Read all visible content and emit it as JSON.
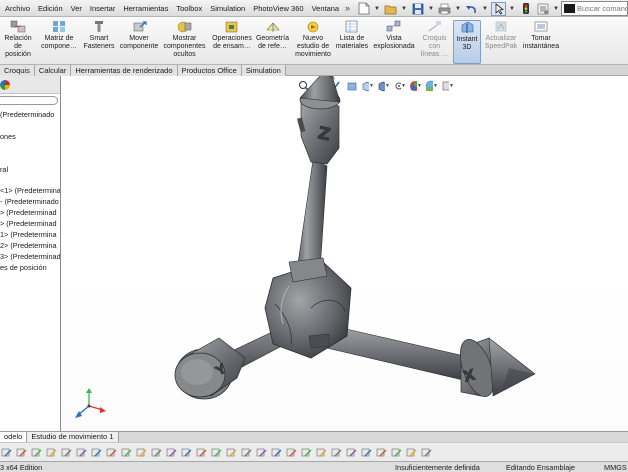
{
  "menubar": {
    "items": [
      "Archivo",
      "Edición",
      "Ver",
      "Insertar",
      "Herramientas",
      "Toolbox",
      "Simulation",
      "PhotoView 360",
      "Ventana"
    ],
    "more_arrow": "»",
    "quick_tools": [
      "new-document-icon",
      "open-folder-icon",
      "save-icon",
      "print-icon",
      "undo-icon",
      "select-pointer-icon",
      "rebuild-icon",
      "options-icon"
    ],
    "search_placeholder": "Buscar comandos"
  },
  "ribbon": {
    "buttons": [
      {
        "label": "Relación\nde\nposición",
        "icon": "mate-icon"
      },
      {
        "label": "Matriz de\ncompone…",
        "icon": "pattern-icon"
      },
      {
        "label": "Smart\nFasteners",
        "icon": "fastener-icon"
      },
      {
        "label": "Mover\ncomponente",
        "icon": "move-component-icon"
      },
      {
        "label": "Mostrar\ncomponentes\nocultos",
        "icon": "show-hidden-icon"
      },
      {
        "label": "Operaciones\nde ensam…",
        "icon": "assembly-features-icon"
      },
      {
        "label": "Geometría\nde refe…",
        "icon": "reference-geometry-icon"
      },
      {
        "label": "Nuevo\nestudio de\nmovimiento",
        "icon": "motion-study-icon"
      },
      {
        "label": "Lista de\nmateriales",
        "icon": "bom-icon"
      },
      {
        "label": "Vista\nexplosionada",
        "icon": "exploded-view-icon"
      },
      {
        "label": "Croquis\ncon\nlíneas …",
        "icon": "explode-line-icon"
      },
      {
        "label": "Instant\n3D",
        "icon": "instant3d-icon"
      },
      {
        "label": "Actualizar\nSpeedPak",
        "icon": "speedpak-icon"
      },
      {
        "label": "Tomar\ninstantánea",
        "icon": "snapshot-icon"
      }
    ]
  },
  "command_tabs": [
    "Croquis",
    "Calcular",
    "Herramientas de renderizado",
    "Productos Office",
    "Simulation"
  ],
  "feature_tree": {
    "rows": [
      "(Predeterminado",
      "",
      "ones",
      "",
      "",
      "ral",
      "",
      "<1> (Predetermina",
      "- (Predeterminado",
      "> (Predeterminad",
      "> (Predeterminad",
      "1> (Predetermina",
      "2> (Predetermina",
      "3> (Predeterminad",
      "es de posición"
    ]
  },
  "heads_up": [
    "zoom-to-fit-icon",
    "zoom-area-icon",
    "previous-view-icon",
    "section-view-icon",
    "view-orientation-icon",
    "display-style-icon",
    "hide-show-icon",
    "edit-appearance-icon",
    "apply-scene-icon",
    "view-settings-icon"
  ],
  "model": {
    "letter_marks": [
      "Z",
      "Y",
      "X"
    ],
    "colors": {
      "body": "#6d6f73",
      "light": "#9a9ca0",
      "dark": "#2e2f33",
      "mid": "#50525a"
    }
  },
  "bottom_tabs": {
    "items": [
      "odelo",
      "Estudio de movimiento 1"
    ],
    "active": 0
  },
  "motion_toolbar": [
    "rotate-icon",
    "zoom-icon",
    "pan-icon",
    "rotate-view-icon",
    "motion-icon",
    "gravity-icon",
    "contact-icon",
    "motor-icon",
    "spring-icon",
    "damper-icon",
    "force-icon",
    "calculate-icon",
    "results-icon",
    "play-icon",
    "stop-icon",
    "settings-icon",
    "camera-icon",
    "export-icon",
    "key-icon",
    "timeline-icon",
    "animation-icon",
    "wizard-icon",
    "playback-icon",
    "help-icon",
    "filter-icon",
    "zoom-in-icon",
    "zoom-out-icon",
    "fit-icon",
    "grid-icon"
  ],
  "status": {
    "edition": "3 x64 Edition",
    "state": "Insuficientemente definida",
    "mode": "Editando Ensamblaje",
    "units": "MMGS",
    "help": "?"
  }
}
